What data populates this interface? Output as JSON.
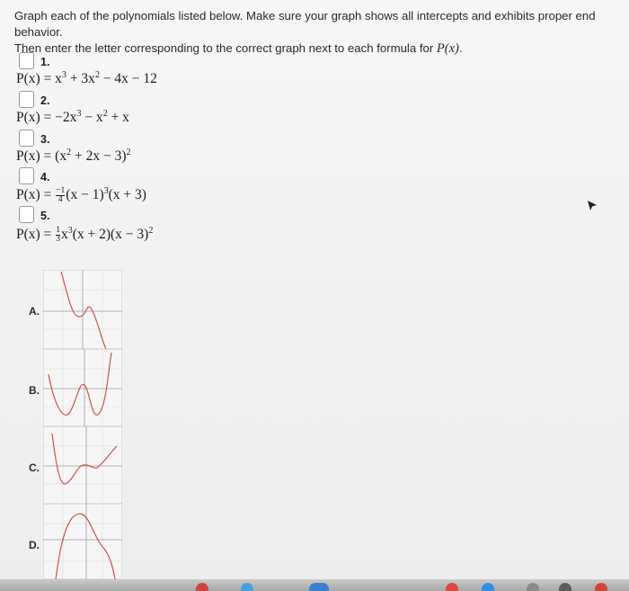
{
  "instructions": {
    "line1": "Graph each of the polynomials listed below. Make sure your graph shows all intercepts and exhibits proper end behavior.",
    "line2_prefix": "Then enter the letter corresponding to the correct graph next to each formula for ",
    "line2_var": "P(x)",
    "line2_suffix": "."
  },
  "items": [
    {
      "number": "1.",
      "formula_prefix": "P(x) = x",
      "answer": ""
    },
    {
      "number": "2.",
      "formula_prefix": "P(x) = −2x",
      "answer": ""
    },
    {
      "number": "3.",
      "formula_prefix": "P(x) = (x",
      "answer": ""
    },
    {
      "number": "4.",
      "formula_prefix": "P(x) = ",
      "answer": ""
    },
    {
      "number": "5.",
      "formula_prefix": "P(x) = ",
      "answer": ""
    }
  ],
  "formula_parts": {
    "f1": {
      "a": "P(x) = x",
      "e1": "3",
      "b": " + 3x",
      "e2": "2",
      "c": " − 4x − 12"
    },
    "f2": {
      "a": "P(x) = −2x",
      "e1": "3",
      "b": " − x",
      "e2": "2",
      "c": " + x"
    },
    "f3": {
      "a": "P(x) = (x",
      "e1": "2",
      "b": " + 2x − 3)",
      "e2": "2"
    },
    "f4": {
      "a": "P(x) = ",
      "num": "−1",
      "den": "4",
      "b": "(x − 1)",
      "e1": "3",
      "c": "(x + 3)"
    },
    "f5": {
      "a": "P(x) = ",
      "num": "1",
      "den": "3",
      "b": "x",
      "e1": "3",
      "c": "(x + 2)(x − 3)",
      "e2": "2"
    }
  },
  "graphs": [
    {
      "label": "A.",
      "shape": "graph-A"
    },
    {
      "label": "B.",
      "shape": "graph-B"
    },
    {
      "label": "C.",
      "shape": "graph-C"
    },
    {
      "label": "D.",
      "shape": "graph-D"
    }
  ],
  "colors": {
    "curve": "#c9564c",
    "grid": "#c8c8c8",
    "axis": "#9c9c9c"
  }
}
